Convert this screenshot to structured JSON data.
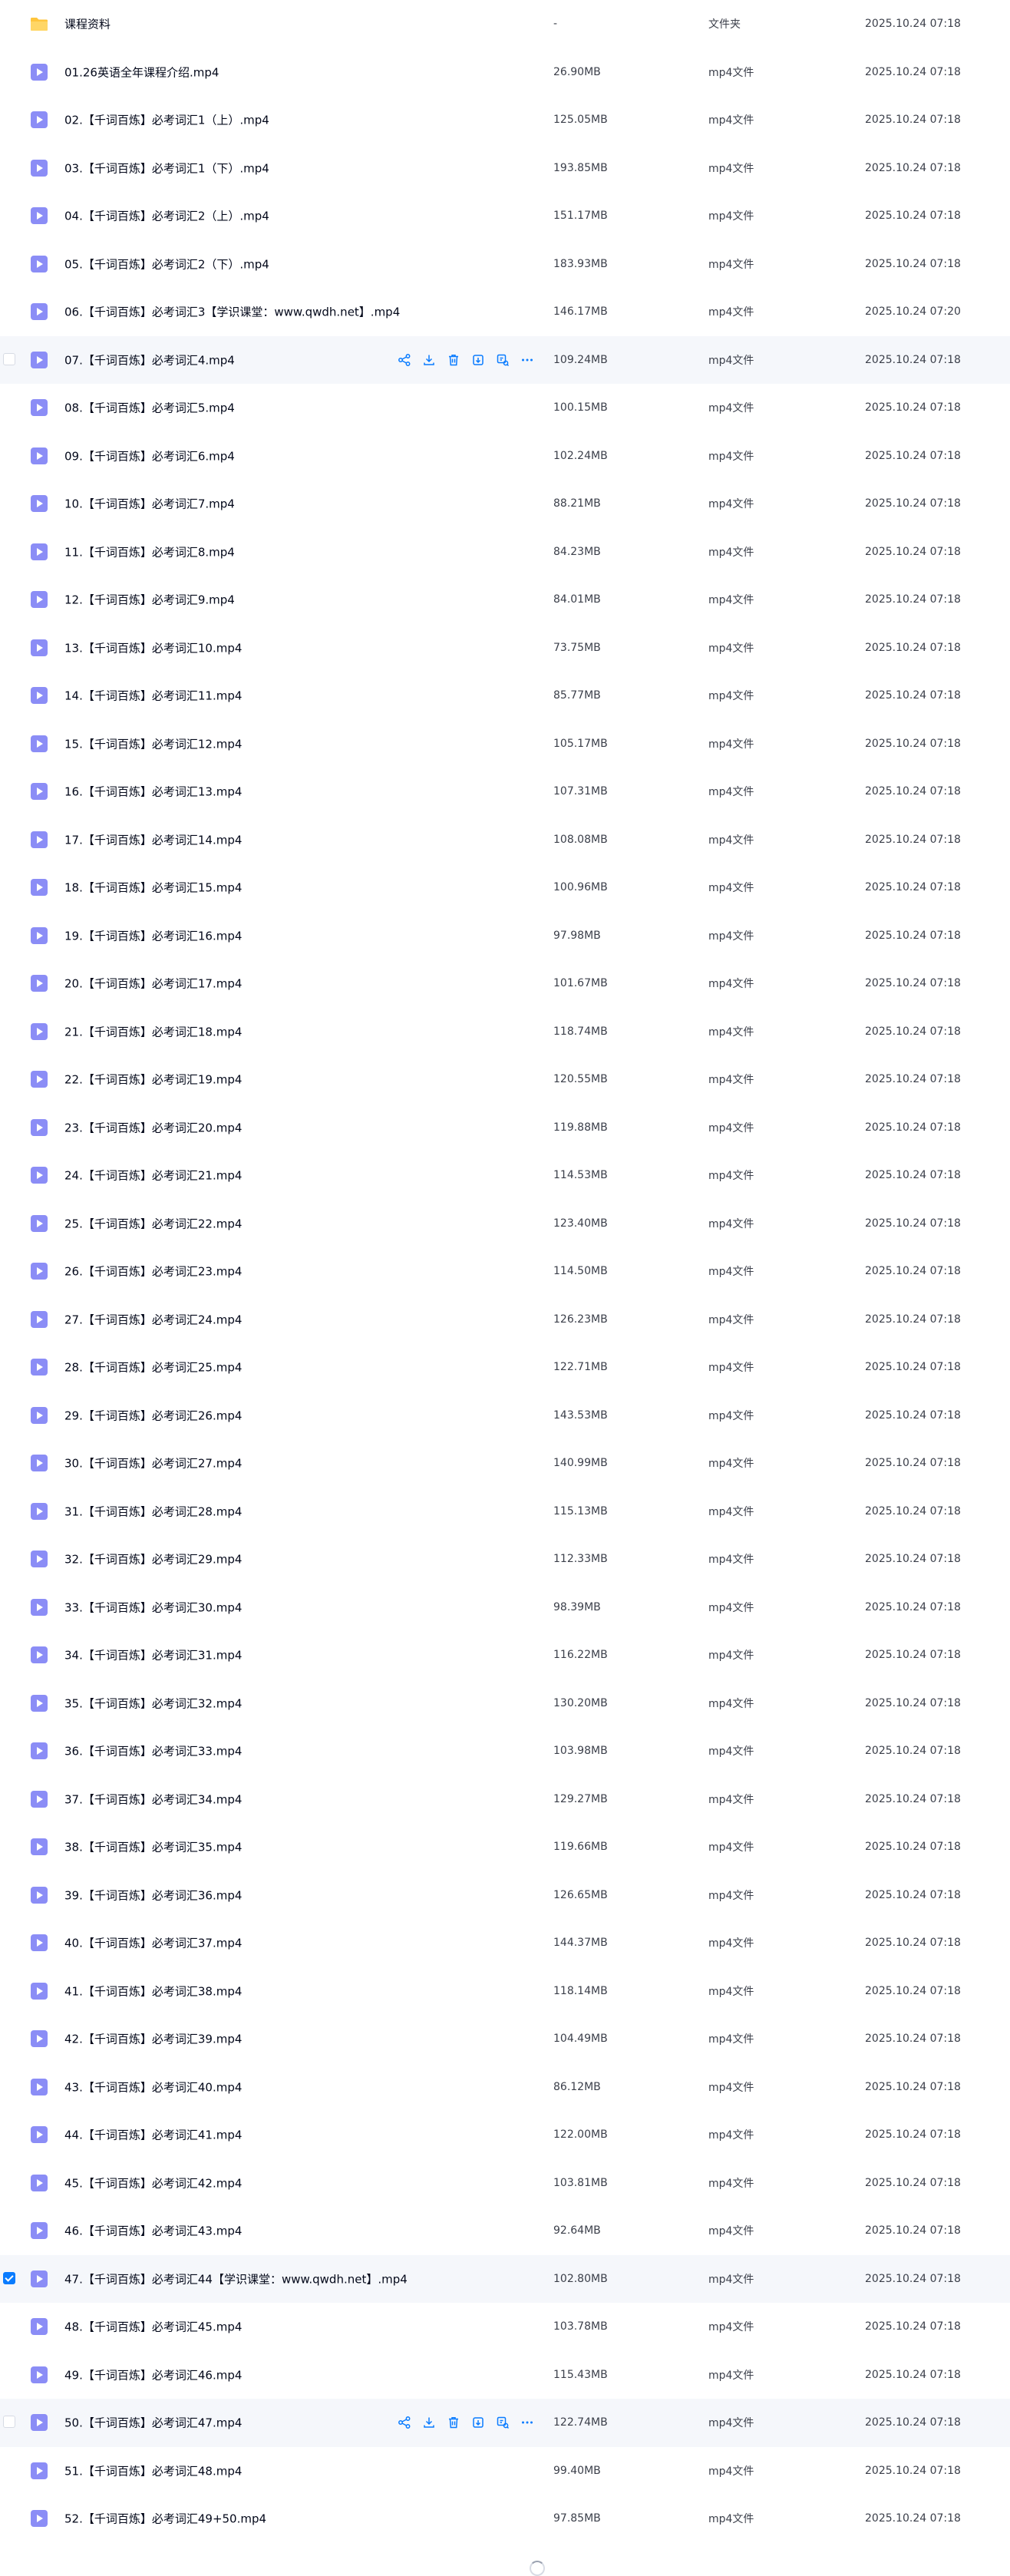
{
  "colors": {
    "accent": "#0a7cff",
    "video_icon": "#8b8df6",
    "folder_icon": "#ffc53d",
    "row_highlight": "#f5f7fb"
  },
  "row_actions": [
    {
      "name": "share-icon"
    },
    {
      "name": "download-icon"
    },
    {
      "name": "delete-icon"
    },
    {
      "name": "copy-icon"
    },
    {
      "name": "move-icon"
    },
    {
      "name": "more-icon"
    }
  ],
  "files": [
    {
      "name": "课程资料",
      "size": "-",
      "type": "文件夹",
      "date": "2025.10.24 07:18",
      "icon": "folder-icon"
    },
    {
      "name": "01.26英语全年课程介绍.mp4",
      "size": "26.90MB",
      "type": "mp4文件",
      "date": "2025.10.24 07:18",
      "icon": "video-icon"
    },
    {
      "name": "02.【千词百炼】必考词汇1（上）.mp4",
      "size": "125.05MB",
      "type": "mp4文件",
      "date": "2025.10.24 07:18",
      "icon": "video-icon"
    },
    {
      "name": "03.【千词百炼】必考词汇1（下）.mp4",
      "size": "193.85MB",
      "type": "mp4文件",
      "date": "2025.10.24 07:18",
      "icon": "video-icon"
    },
    {
      "name": "04.【千词百炼】必考词汇2（上）.mp4",
      "size": "151.17MB",
      "type": "mp4文件",
      "date": "2025.10.24 07:18",
      "icon": "video-icon"
    },
    {
      "name": "05.【千词百炼】必考词汇2（下）.mp4",
      "size": "183.93MB",
      "type": "mp4文件",
      "date": "2025.10.24 07:18",
      "icon": "video-icon"
    },
    {
      "name": "06.【千词百炼】必考词汇3【学识课堂：www.qwdh.net】.mp4",
      "size": "146.17MB",
      "type": "mp4文件",
      "date": "2025.10.24 07:20",
      "icon": "video-icon"
    },
    {
      "name": "07.【千词百炼】必考词汇4.mp4",
      "size": "109.24MB",
      "type": "mp4文件",
      "date": "2025.10.24 07:18",
      "icon": "video-icon",
      "state": "hover"
    },
    {
      "name": "08.【千词百炼】必考词汇5.mp4",
      "size": "100.15MB",
      "type": "mp4文件",
      "date": "2025.10.24 07:18",
      "icon": "video-icon"
    },
    {
      "name": "09.【千词百炼】必考词汇6.mp4",
      "size": "102.24MB",
      "type": "mp4文件",
      "date": "2025.10.24 07:18",
      "icon": "video-icon"
    },
    {
      "name": "10.【千词百炼】必考词汇7.mp4",
      "size": "88.21MB",
      "type": "mp4文件",
      "date": "2025.10.24 07:18",
      "icon": "video-icon"
    },
    {
      "name": "11.【千词百炼】必考词汇8.mp4",
      "size": "84.23MB",
      "type": "mp4文件",
      "date": "2025.10.24 07:18",
      "icon": "video-icon"
    },
    {
      "name": "12.【千词百炼】必考词汇9.mp4",
      "size": "84.01MB",
      "type": "mp4文件",
      "date": "2025.10.24 07:18",
      "icon": "video-icon"
    },
    {
      "name": "13.【千词百炼】必考词汇10.mp4",
      "size": "73.75MB",
      "type": "mp4文件",
      "date": "2025.10.24 07:18",
      "icon": "video-icon"
    },
    {
      "name": "14.【千词百炼】必考词汇11.mp4",
      "size": "85.77MB",
      "type": "mp4文件",
      "date": "2025.10.24 07:18",
      "icon": "video-icon"
    },
    {
      "name": "15.【千词百炼】必考词汇12.mp4",
      "size": "105.17MB",
      "type": "mp4文件",
      "date": "2025.10.24 07:18",
      "icon": "video-icon"
    },
    {
      "name": "16.【千词百炼】必考词汇13.mp4",
      "size": "107.31MB",
      "type": "mp4文件",
      "date": "2025.10.24 07:18",
      "icon": "video-icon"
    },
    {
      "name": "17.【千词百炼】必考词汇14.mp4",
      "size": "108.08MB",
      "type": "mp4文件",
      "date": "2025.10.24 07:18",
      "icon": "video-icon"
    },
    {
      "name": "18.【千词百炼】必考词汇15.mp4",
      "size": "100.96MB",
      "type": "mp4文件",
      "date": "2025.10.24 07:18",
      "icon": "video-icon"
    },
    {
      "name": "19.【千词百炼】必考词汇16.mp4",
      "size": "97.98MB",
      "type": "mp4文件",
      "date": "2025.10.24 07:18",
      "icon": "video-icon"
    },
    {
      "name": "20.【千词百炼】必考词汇17.mp4",
      "size": "101.67MB",
      "type": "mp4文件",
      "date": "2025.10.24 07:18",
      "icon": "video-icon"
    },
    {
      "name": "21.【千词百炼】必考词汇18.mp4",
      "size": "118.74MB",
      "type": "mp4文件",
      "date": "2025.10.24 07:18",
      "icon": "video-icon"
    },
    {
      "name": "22.【千词百炼】必考词汇19.mp4",
      "size": "120.55MB",
      "type": "mp4文件",
      "date": "2025.10.24 07:18",
      "icon": "video-icon"
    },
    {
      "name": "23.【千词百炼】必考词汇20.mp4",
      "size": "119.88MB",
      "type": "mp4文件",
      "date": "2025.10.24 07:18",
      "icon": "video-icon"
    },
    {
      "name": "24.【千词百炼】必考词汇21.mp4",
      "size": "114.53MB",
      "type": "mp4文件",
      "date": "2025.10.24 07:18",
      "icon": "video-icon"
    },
    {
      "name": "25.【千词百炼】必考词汇22.mp4",
      "size": "123.40MB",
      "type": "mp4文件",
      "date": "2025.10.24 07:18",
      "icon": "video-icon"
    },
    {
      "name": "26.【千词百炼】必考词汇23.mp4",
      "size": "114.50MB",
      "type": "mp4文件",
      "date": "2025.10.24 07:18",
      "icon": "video-icon"
    },
    {
      "name": "27.【千词百炼】必考词汇24.mp4",
      "size": "126.23MB",
      "type": "mp4文件",
      "date": "2025.10.24 07:18",
      "icon": "video-icon"
    },
    {
      "name": "28.【千词百炼】必考词汇25.mp4",
      "size": "122.71MB",
      "type": "mp4文件",
      "date": "2025.10.24 07:18",
      "icon": "video-icon"
    },
    {
      "name": "29.【千词百炼】必考词汇26.mp4",
      "size": "143.53MB",
      "type": "mp4文件",
      "date": "2025.10.24 07:18",
      "icon": "video-icon"
    },
    {
      "name": "30.【千词百炼】必考词汇27.mp4",
      "size": "140.99MB",
      "type": "mp4文件",
      "date": "2025.10.24 07:18",
      "icon": "video-icon"
    },
    {
      "name": "31.【千词百炼】必考词汇28.mp4",
      "size": "115.13MB",
      "type": "mp4文件",
      "date": "2025.10.24 07:18",
      "icon": "video-icon"
    },
    {
      "name": "32.【千词百炼】必考词汇29.mp4",
      "size": "112.33MB",
      "type": "mp4文件",
      "date": "2025.10.24 07:18",
      "icon": "video-icon"
    },
    {
      "name": "33.【千词百炼】必考词汇30.mp4",
      "size": "98.39MB",
      "type": "mp4文件",
      "date": "2025.10.24 07:18",
      "icon": "video-icon"
    },
    {
      "name": "34.【千词百炼】必考词汇31.mp4",
      "size": "116.22MB",
      "type": "mp4文件",
      "date": "2025.10.24 07:18",
      "icon": "video-icon"
    },
    {
      "name": "35.【千词百炼】必考词汇32.mp4",
      "size": "130.20MB",
      "type": "mp4文件",
      "date": "2025.10.24 07:18",
      "icon": "video-icon"
    },
    {
      "name": "36.【千词百炼】必考词汇33.mp4",
      "size": "103.98MB",
      "type": "mp4文件",
      "date": "2025.10.24 07:18",
      "icon": "video-icon"
    },
    {
      "name": "37.【千词百炼】必考词汇34.mp4",
      "size": "129.27MB",
      "type": "mp4文件",
      "date": "2025.10.24 07:18",
      "icon": "video-icon"
    },
    {
      "name": "38.【千词百炼】必考词汇35.mp4",
      "size": "119.66MB",
      "type": "mp4文件",
      "date": "2025.10.24 07:18",
      "icon": "video-icon"
    },
    {
      "name": "39.【千词百炼】必考词汇36.mp4",
      "size": "126.65MB",
      "type": "mp4文件",
      "date": "2025.10.24 07:18",
      "icon": "video-icon"
    },
    {
      "name": "40.【千词百炼】必考词汇37.mp4",
      "size": "144.37MB",
      "type": "mp4文件",
      "date": "2025.10.24 07:18",
      "icon": "video-icon"
    },
    {
      "name": "41.【千词百炼】必考词汇38.mp4",
      "size": "118.14MB",
      "type": "mp4文件",
      "date": "2025.10.24 07:18",
      "icon": "video-icon"
    },
    {
      "name": "42.【千词百炼】必考词汇39.mp4",
      "size": "104.49MB",
      "type": "mp4文件",
      "date": "2025.10.24 07:18",
      "icon": "video-icon"
    },
    {
      "name": "43.【千词百炼】必考词汇40.mp4",
      "size": "86.12MB",
      "type": "mp4文件",
      "date": "2025.10.24 07:18",
      "icon": "video-icon"
    },
    {
      "name": "44.【千词百炼】必考词汇41.mp4",
      "size": "122.00MB",
      "type": "mp4文件",
      "date": "2025.10.24 07:18",
      "icon": "video-icon"
    },
    {
      "name": "45.【千词百炼】必考词汇42.mp4",
      "size": "103.81MB",
      "type": "mp4文件",
      "date": "2025.10.24 07:18",
      "icon": "video-icon"
    },
    {
      "name": "46.【千词百炼】必考词汇43.mp4",
      "size": "92.64MB",
      "type": "mp4文件",
      "date": "2025.10.24 07:18",
      "icon": "video-icon"
    },
    {
      "name": "47.【千词百炼】必考词汇44【学识课堂：www.qwdh.net】.mp4",
      "size": "102.80MB",
      "type": "mp4文件",
      "date": "2025.10.24 07:18",
      "icon": "video-icon",
      "state": "selected"
    },
    {
      "name": "48.【千词百炼】必考词汇45.mp4",
      "size": "103.78MB",
      "type": "mp4文件",
      "date": "2025.10.24 07:18",
      "icon": "video-icon"
    },
    {
      "name": "49.【千词百炼】必考词汇46.mp4",
      "size": "115.43MB",
      "type": "mp4文件",
      "date": "2025.10.24 07:18",
      "icon": "video-icon"
    },
    {
      "name": "50.【千词百炼】必考词汇47.mp4",
      "size": "122.74MB",
      "type": "mp4文件",
      "date": "2025.10.24 07:18",
      "icon": "video-icon",
      "state": "hover"
    },
    {
      "name": "51.【千词百炼】必考词汇48.mp4",
      "size": "99.40MB",
      "type": "mp4文件",
      "date": "2025.10.24 07:18",
      "icon": "video-icon"
    },
    {
      "name": "52.【千词百炼】必考词汇49+50.mp4",
      "size": "97.85MB",
      "type": "mp4文件",
      "date": "2025.10.24 07:18",
      "icon": "video-icon"
    }
  ]
}
